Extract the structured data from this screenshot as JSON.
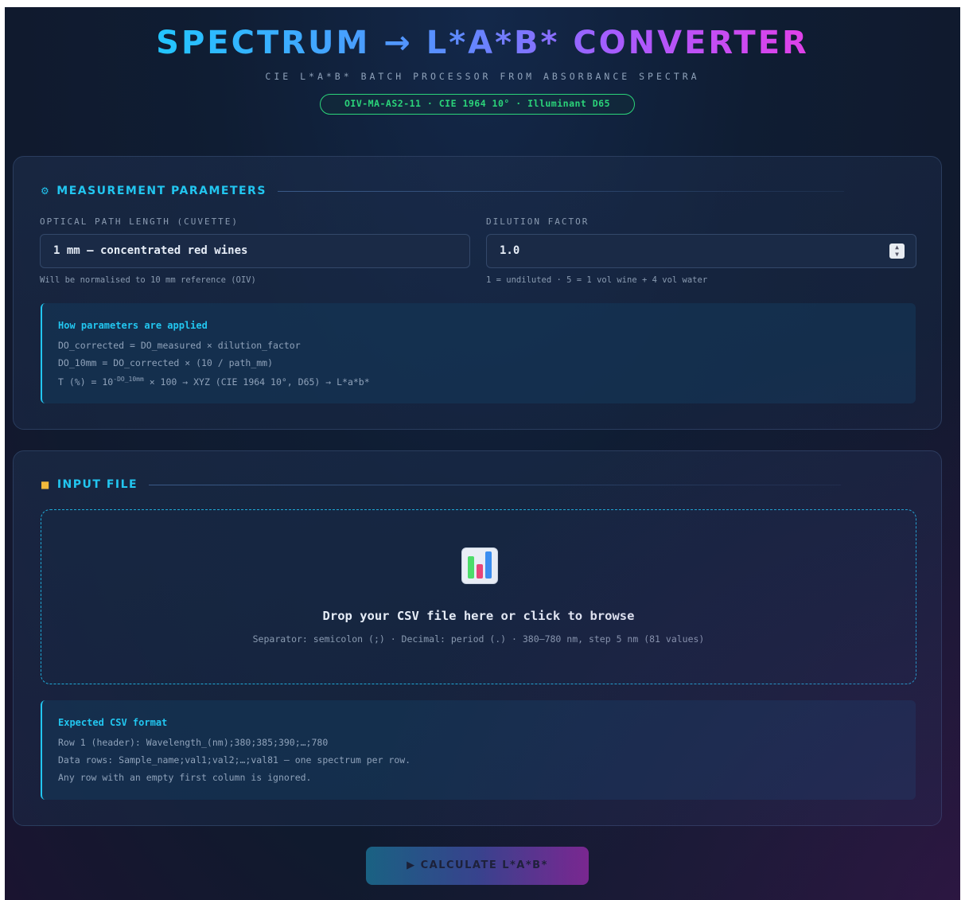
{
  "header": {
    "title": "SPECTRUM → L*A*B* CONVERTER",
    "subtitle": "CIE L*A*B* BATCH PROCESSOR FROM ABSORBANCE SPECTRA",
    "badge": "OIV-MA-AS2-11 · CIE 1964 10° · Illuminant D65"
  },
  "params": {
    "section_title": "MEASUREMENT PARAMETERS",
    "section_icon": "gear-icon",
    "path_length": {
      "label": "OPTICAL PATH LENGTH (CUVETTE)",
      "value": "1 mm — concentrated red wines",
      "hint": "Will be normalised to 10 mm reference (OIV)"
    },
    "dilution": {
      "label": "DILUTION FACTOR",
      "value": "1.0",
      "hint": "1 = undiluted · 5 = 1 vol wine + 4 vol water"
    },
    "info": {
      "title": "How parameters are applied",
      "line1": "DO_corrected = DO_measured × dilution_factor",
      "line2": "DO_10mm = DO_corrected × (10 / path_mm)",
      "line3_prefix": "T (%) = 10",
      "line3_sup": "-DO_10mm",
      "line3_suffix": " × 100 → XYZ (CIE 1964 10°, D65) → L*a*b*"
    }
  },
  "input": {
    "section_title": "INPUT FILE",
    "section_icon": "folder-icon",
    "drop_icon": "bar-chart-icon",
    "drop_title": "Drop your CSV file here or click to browse",
    "drop_sub": "Separator: semicolon (;) · Decimal: period (.) · 380–780 nm, step 5 nm (81 values)",
    "format": {
      "title": "Expected CSV format",
      "line1": "Row 1 (header): Wavelength_(nm);380;385;390;…;780",
      "line2": "Data rows: Sample_name;val1;val2;…;val81 — one spectrum per row.",
      "line3": "Any row with an empty first column is ignored."
    }
  },
  "action": {
    "calculate_label": "▶ CALCULATE L*A*B*"
  },
  "colors": {
    "accent_cyan": "#22c6f0",
    "accent_green": "#2bd47a",
    "accent_magenta": "#e040e8"
  }
}
